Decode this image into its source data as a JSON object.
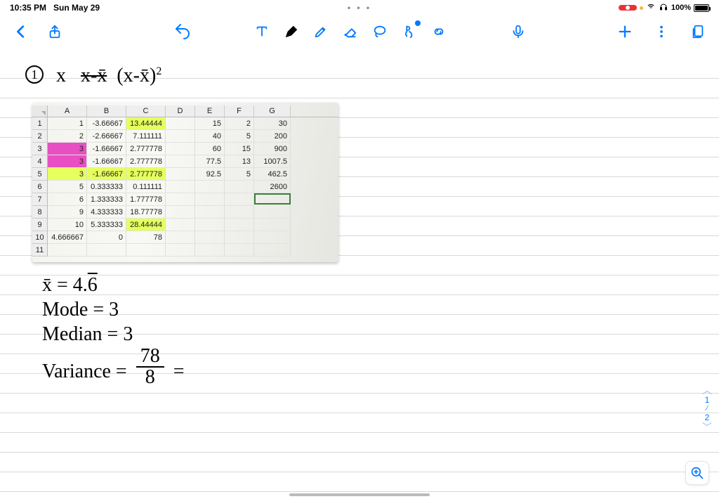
{
  "status": {
    "time": "10:35 PM",
    "date": "Sun May 29",
    "ellipsis": "• • •",
    "battery_pct": "100%"
  },
  "toolbar": {
    "back": "Back",
    "share": "Share",
    "undo": "Undo",
    "text": "Text",
    "pen": "Pen",
    "highlighter": "Highlighter",
    "eraser": "Eraser",
    "lasso": "Lasso",
    "hand": "Hand",
    "link": "Link",
    "mic": "Microphone",
    "add": "Add",
    "more": "More",
    "pages": "Pages"
  },
  "handwriting": {
    "problem_number": "1",
    "header": "x   x-x̄   (x-x̄)²",
    "xbar_line": "x̄ = 4.6̄",
    "mode_line": "Mode = 3",
    "median_line": "Median = 3",
    "variance_label": "Variance =",
    "variance_num": "78",
    "variance_den": "8",
    "equals": "="
  },
  "spreadsheet": {
    "columns": [
      "A",
      "B",
      "C",
      "D",
      "E",
      "F",
      "G"
    ],
    "row_labels": [
      "1",
      "2",
      "3",
      "4",
      "5",
      "6",
      "7",
      "8",
      "9",
      "10",
      "11"
    ],
    "rows": [
      {
        "A": "1",
        "B": "-3.66667",
        "C": "13.44444",
        "D": "",
        "E": "15",
        "F": "2",
        "G": "30"
      },
      {
        "A": "2",
        "B": "-2.66667",
        "C": "7.111111",
        "D": "",
        "E": "40",
        "F": "5",
        "G": "200"
      },
      {
        "A": "3",
        "B": "-1.66667",
        "C": "2.777778",
        "D": "",
        "E": "60",
        "F": "15",
        "G": "900"
      },
      {
        "A": "3",
        "B": "-1.66667",
        "C": "2.777778",
        "D": "",
        "E": "77.5",
        "F": "13",
        "G": "1007.5"
      },
      {
        "A": "3",
        "B": "-1.66667",
        "C": "2.777778",
        "D": "",
        "E": "92.5",
        "F": "5",
        "G": "462.5"
      },
      {
        "A": "5",
        "B": "0.333333",
        "C": "0.111111",
        "D": "",
        "E": "",
        "F": "",
        "G": "2600"
      },
      {
        "A": "6",
        "B": "1.333333",
        "C": "1.777778",
        "D": "",
        "E": "",
        "F": "",
        "G": ""
      },
      {
        "A": "9",
        "B": "4.333333",
        "C": "18.77778",
        "D": "",
        "E": "",
        "F": "",
        "G": ""
      },
      {
        "A": "10",
        "B": "5.333333",
        "C": "28.44444",
        "D": "",
        "E": "",
        "F": "",
        "G": ""
      },
      {
        "A": "4.666667",
        "B": "0",
        "C": "78",
        "D": "",
        "E": "",
        "F": "",
        "G": ""
      },
      {
        "A": "",
        "B": "",
        "C": "",
        "D": "",
        "E": "",
        "F": "",
        "G": ""
      }
    ]
  },
  "pagenav": {
    "up": "︿",
    "current": "1",
    "sep": "⁄",
    "total": "2",
    "down": "﹀"
  },
  "zoom": {
    "label": "Zoom In"
  }
}
